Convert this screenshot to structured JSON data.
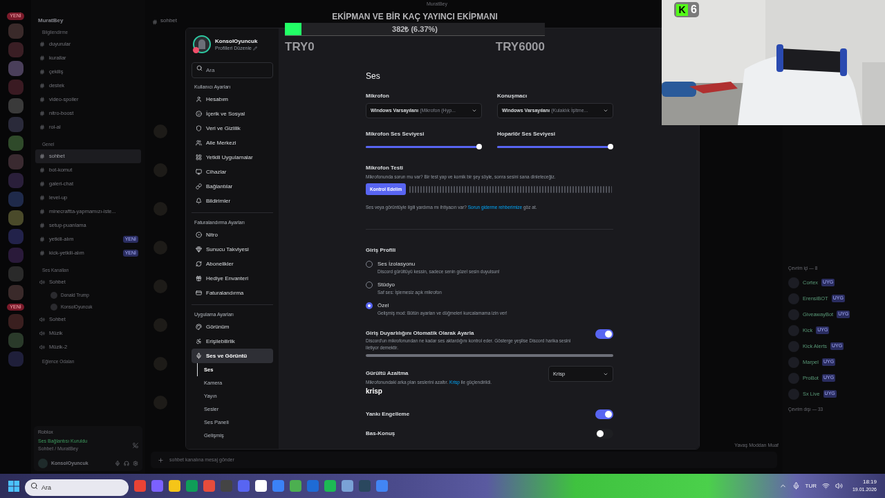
{
  "app_title": "MuratBey",
  "server": {
    "name": "MuratBey",
    "new_badges": [
      "YENİ",
      "YENİ"
    ],
    "channel_groups": [
      {
        "category": "Bilgilendirme",
        "channels": [
          {
            "name": "duyurular",
            "selected": false
          },
          {
            "name": "kurallar",
            "selected": false
          },
          {
            "name": "çekiliş",
            "selected": false
          },
          {
            "name": "destek",
            "selected": false
          },
          {
            "name": "video-spoiler",
            "selected": false
          },
          {
            "name": "nitro-boost",
            "selected": false
          },
          {
            "name": "rol-al",
            "selected": false
          }
        ]
      },
      {
        "category": "Genel",
        "channels": [
          {
            "name": "sohbet",
            "selected": true
          },
          {
            "name": "bot-komut",
            "selected": false
          },
          {
            "name": "galeri-chat",
            "selected": false
          },
          {
            "name": "level-up",
            "selected": false
          },
          {
            "name": "minecraftta-yapmamızı-iste...",
            "selected": false
          },
          {
            "name": "setup-puanlama",
            "selected": false
          },
          {
            "name": "yetkili-alım",
            "selected": false,
            "badge": "YENİ"
          },
          {
            "name": "kick-yetkili-alım",
            "selected": false,
            "badge": "YENİ"
          }
        ]
      }
    ],
    "voice_category": "Ses Kanalları",
    "voice_channels": [
      {
        "name": "Sohbet",
        "users": [
          "Donald Trump",
          "KonsolOyuncuk"
        ]
      },
      {
        "name": "Sohbet"
      },
      {
        "name": "Müzik"
      },
      {
        "name": "Müzik-2"
      }
    ],
    "fun_category": "Eğlence Odaları",
    "activity": "Roblox",
    "voice_status": "Ses Bağlantısı Kuruldu",
    "voice_location": "Sohbet / MuratBey",
    "user": "KonsolOyuncuk"
  },
  "chat": {
    "channel": "sohbet",
    "input_placeholder": "sohbet kanalına mesaj gönder",
    "slowmode": "Yavaş Moddan Muaf"
  },
  "members": {
    "groups": [
      {
        "title": "Çevrim içi — 8",
        "members": [
          {
            "name": "Cortex",
            "tag": "UYG"
          },
          {
            "name": "ErensiBOT",
            "tag": "UYG"
          },
          {
            "name": "GiveawayBot",
            "tag": "UYG"
          },
          {
            "name": "Kick",
            "tag": "UYG"
          },
          {
            "name": "Kick Alerts",
            "tag": "UYG"
          },
          {
            "name": "Marpel",
            "tag": "UYG"
          },
          {
            "name": "ProBot",
            "tag": "UYG"
          },
          {
            "name": "Sx Live",
            "tag": "UYG"
          }
        ]
      },
      {
        "title": "Çevrim dışı — 33"
      }
    ]
  },
  "settings": {
    "profile": {
      "name": "KonsolOyuncuk",
      "subtitle": "Profilleri Düzenle"
    },
    "search": {
      "placeholder": "Ara"
    },
    "sections": [
      {
        "title": "Kullanıcı Ayarları",
        "items": [
          {
            "label": "Hesabım",
            "selected": false
          },
          {
            "label": "İçerik ve Sosyal",
            "selected": false
          },
          {
            "label": "Veri ve Gizlilik",
            "selected": false
          },
          {
            "label": "Aile Merkezi",
            "selected": false
          },
          {
            "label": "Yetkili Uygulamalar",
            "selected": false
          },
          {
            "label": "Cihazlar",
            "selected": false
          },
          {
            "label": "Bağlantılar",
            "selected": false
          },
          {
            "label": "Bildirimler",
            "selected": false
          }
        ]
      },
      {
        "title": "Faturalandırma Ayarları",
        "items": [
          {
            "label": "Nitro",
            "selected": false
          },
          {
            "label": "Sunucu Takviyesi",
            "selected": false
          },
          {
            "label": "Abonelikler",
            "selected": false
          },
          {
            "label": "Hediye Envanteri",
            "selected": false
          },
          {
            "label": "Faturalandırma",
            "selected": false
          }
        ]
      },
      {
        "title": "Uygulama Ayarları",
        "items": [
          {
            "label": "Görünüm",
            "selected": false
          },
          {
            "label": "Erişilebilirlik",
            "selected": false
          },
          {
            "label": "Ses ve Görüntü",
            "selected": true,
            "children": [
              {
                "label": "Ses",
                "selected": true
              },
              {
                "label": "Kamera",
                "selected": false
              },
              {
                "label": "Yayın",
                "selected": false
              },
              {
                "label": "Sesler",
                "selected": false
              },
              {
                "label": "Ses Paneli",
                "selected": false
              },
              {
                "label": "Gelişmiş",
                "selected": false
              }
            ]
          }
        ]
      }
    ],
    "heading": "Ses",
    "devices": [
      {
        "label": "Mikrofon",
        "value": "Windows Varsayılanı",
        "detail": "(Mikrofon (Hyp..."
      },
      {
        "label": "Konuşmacı",
        "value": "Windows Varsayılanı",
        "detail": "(Kulaklık İşitme..."
      }
    ],
    "volumes": [
      {
        "label": "Mikrofon Ses Seviyesi",
        "level": 1.0
      },
      {
        "label": "Hoparlör Ses Seviyesi",
        "level": 1.0
      }
    ],
    "mic_test": {
      "title": "Mikrofon Testi",
      "description": "Mikrofonunda sorun mu var? Bir test yap ve komik bir şey söyle, sonra sesini sana dinleteceğiz.",
      "button": "Kontrol Edelim"
    },
    "help": {
      "before": "Ses veya görüntüyle ilgili yardıma mı ihtiyacın var?",
      "link": "Sorun giderme rehberimize",
      "after": "göz at."
    },
    "input_profile": {
      "title": "Giriş Profili",
      "options": [
        {
          "label": "Ses İzolasyonu",
          "description": "Discord gürültüyü kessin, sadece senin güzel sesin duyulsun!",
          "selected": false
        },
        {
          "label": "Stüdyo",
          "description": "Saf ses: İşlemesiz açık mikrofon",
          "selected": false
        },
        {
          "label": "Özel",
          "description": "Gelişmiş mod: Bütün ayarları ve düğmeleri kurcalamama izin ver!",
          "selected": true
        }
      ]
    },
    "auto_sensitivity": {
      "label": "Giriş Duyarlılığını Otomatik Olarak Ayarla",
      "description": "Discord'un mikrofonundan ne kadar ses aktardığını kontrol eder. Gösterge yeşilse Discord harika sesini iletiyor demektir.",
      "on": true
    },
    "noise": {
      "label": "Gürültü Azaltma",
      "before": "Mikrofonundaki arka plan seslerini azaltır.",
      "link": "Krisp",
      "after": "ile güçlendirildi.",
      "logo": "krisp",
      "value": "Krisp"
    },
    "toggles": [
      {
        "label": "Yankı Engelleme",
        "on": true
      },
      {
        "label": "Bas-Konuş",
        "on": false
      }
    ]
  },
  "donation": {
    "title": "EKİPMAN VE BİR KAÇ YAYINCI EKİPMANI",
    "level": 0.0637,
    "amount": "382₺ (6.37%)",
    "min": "TRY0",
    "max": "TRY6000"
  },
  "webcam": {
    "kind": "picture",
    "badge_logo": "K",
    "badge_count": "6"
  },
  "taskbar": {
    "search_placeholder": "Ara",
    "language": "TUR",
    "time": "18:19",
    "date": "19.01.2026"
  }
}
